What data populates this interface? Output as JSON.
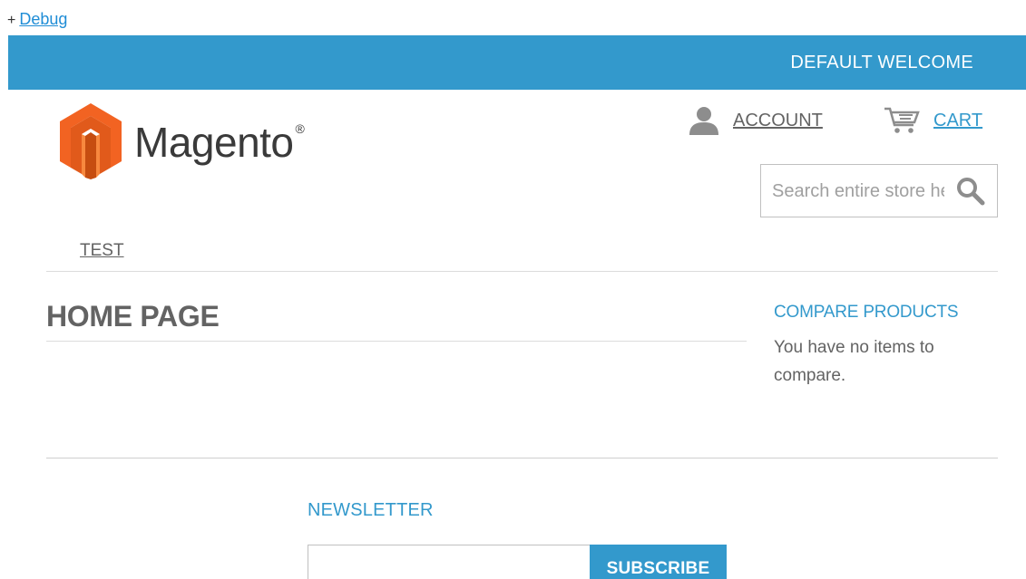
{
  "debug": {
    "prefix": "+",
    "link_label": "Debug"
  },
  "topbar": {
    "welcome": "DEFAULT WELCOME",
    "background": "#3399cc"
  },
  "logo": {
    "wordmark": "Magento",
    "mark": "®",
    "colors": {
      "orange_light": "#f26322",
      "orange_dark": "#c64d10"
    }
  },
  "header": {
    "account_label": "ACCOUNT",
    "account_icon": "user-icon",
    "cart_label": "CART",
    "cart_icon": "cart-icon"
  },
  "search": {
    "placeholder": "Search entire store here...",
    "icon": "search-icon"
  },
  "nav": {
    "items": [
      {
        "label": "TEST"
      }
    ]
  },
  "main": {
    "title": "HOME PAGE"
  },
  "sidebar": {
    "compare_title": "COMPARE PRODUCTS",
    "compare_text": "You have no items to compare."
  },
  "footer": {
    "newsletter_title": "NEWSLETTER",
    "newsletter_value": "",
    "subscribe_label": "SUBSCRIBE"
  },
  "colors": {
    "accent": "#3399cc",
    "text": "#636363",
    "divider": "#dcdcdc"
  }
}
